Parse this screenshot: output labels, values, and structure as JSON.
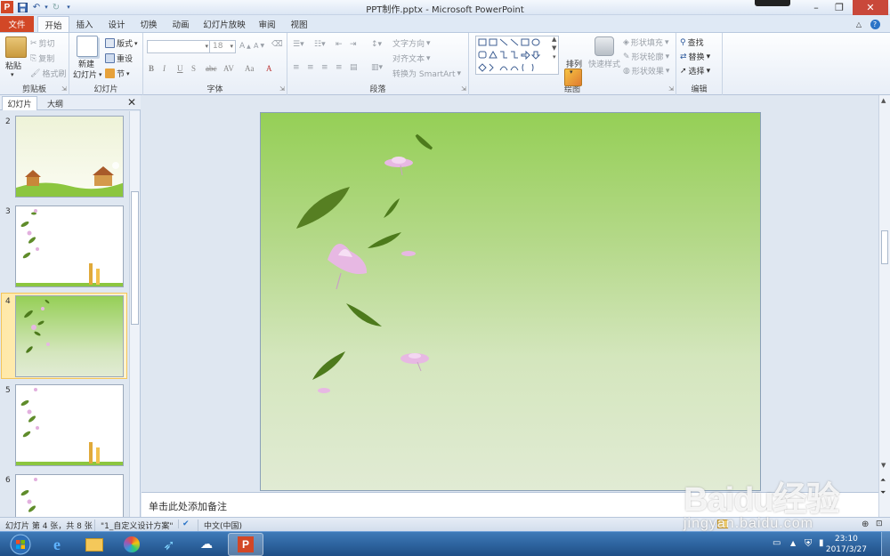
{
  "window": {
    "title": "PPT制作.pptx - Microsoft PowerPoint"
  },
  "ribbon_tabs": [
    "文件",
    "开始",
    "插入",
    "设计",
    "切换",
    "动画",
    "幻灯片放映",
    "审阅",
    "视图"
  ],
  "ribbon": {
    "clipboard": {
      "label": "剪贴板",
      "paste": "粘贴",
      "cut": "剪切",
      "copy": "复制",
      "format_painter": "格式刷"
    },
    "slides": {
      "label": "幻灯片",
      "new_slide_line1": "新建",
      "new_slide_line2": "幻灯片",
      "layout": "版式",
      "reset": "重设",
      "section": "节"
    },
    "font": {
      "label": "字体",
      "size": "18"
    },
    "paragraph": {
      "label": "段落",
      "text_direction": "文字方向",
      "align_text": "对齐文本",
      "convert_smartart": "转换为 SmartArt"
    },
    "drawing": {
      "label": "绘图",
      "arrange": "排列",
      "quick_styles": "快速样式",
      "shape_fill": "形状填充",
      "shape_outline": "形状轮廓",
      "shape_effects": "形状效果"
    },
    "editing": {
      "label": "编辑",
      "find": "查找",
      "replace": "替换",
      "select": "选择"
    }
  },
  "left_panel": {
    "tab_slides": "幻灯片",
    "tab_outline": "大纲",
    "thumbnails": [
      {
        "num": "2"
      },
      {
        "num": "3"
      },
      {
        "num": "4"
      },
      {
        "num": "5"
      },
      {
        "num": "6"
      }
    ]
  },
  "notes": {
    "placeholder": "单击此处添加备注"
  },
  "statusbar": {
    "slide_info": "幻灯片 第 4 张，共 8 张",
    "theme": "\"1_自定义设计方案\"",
    "language": "中文(中国)"
  },
  "taskbar": {
    "time": "23:10",
    "date": "2017/3/27"
  },
  "watermark": {
    "brand": "Baidu经验",
    "url": "jingyan.baidu.com"
  },
  "colors": {
    "file_tab": "#d24726",
    "slide_top": "#95cf56",
    "slide_bottom": "#e1ebd4",
    "leaf": "#4d7a1c",
    "petal": "#e7b8e3"
  }
}
